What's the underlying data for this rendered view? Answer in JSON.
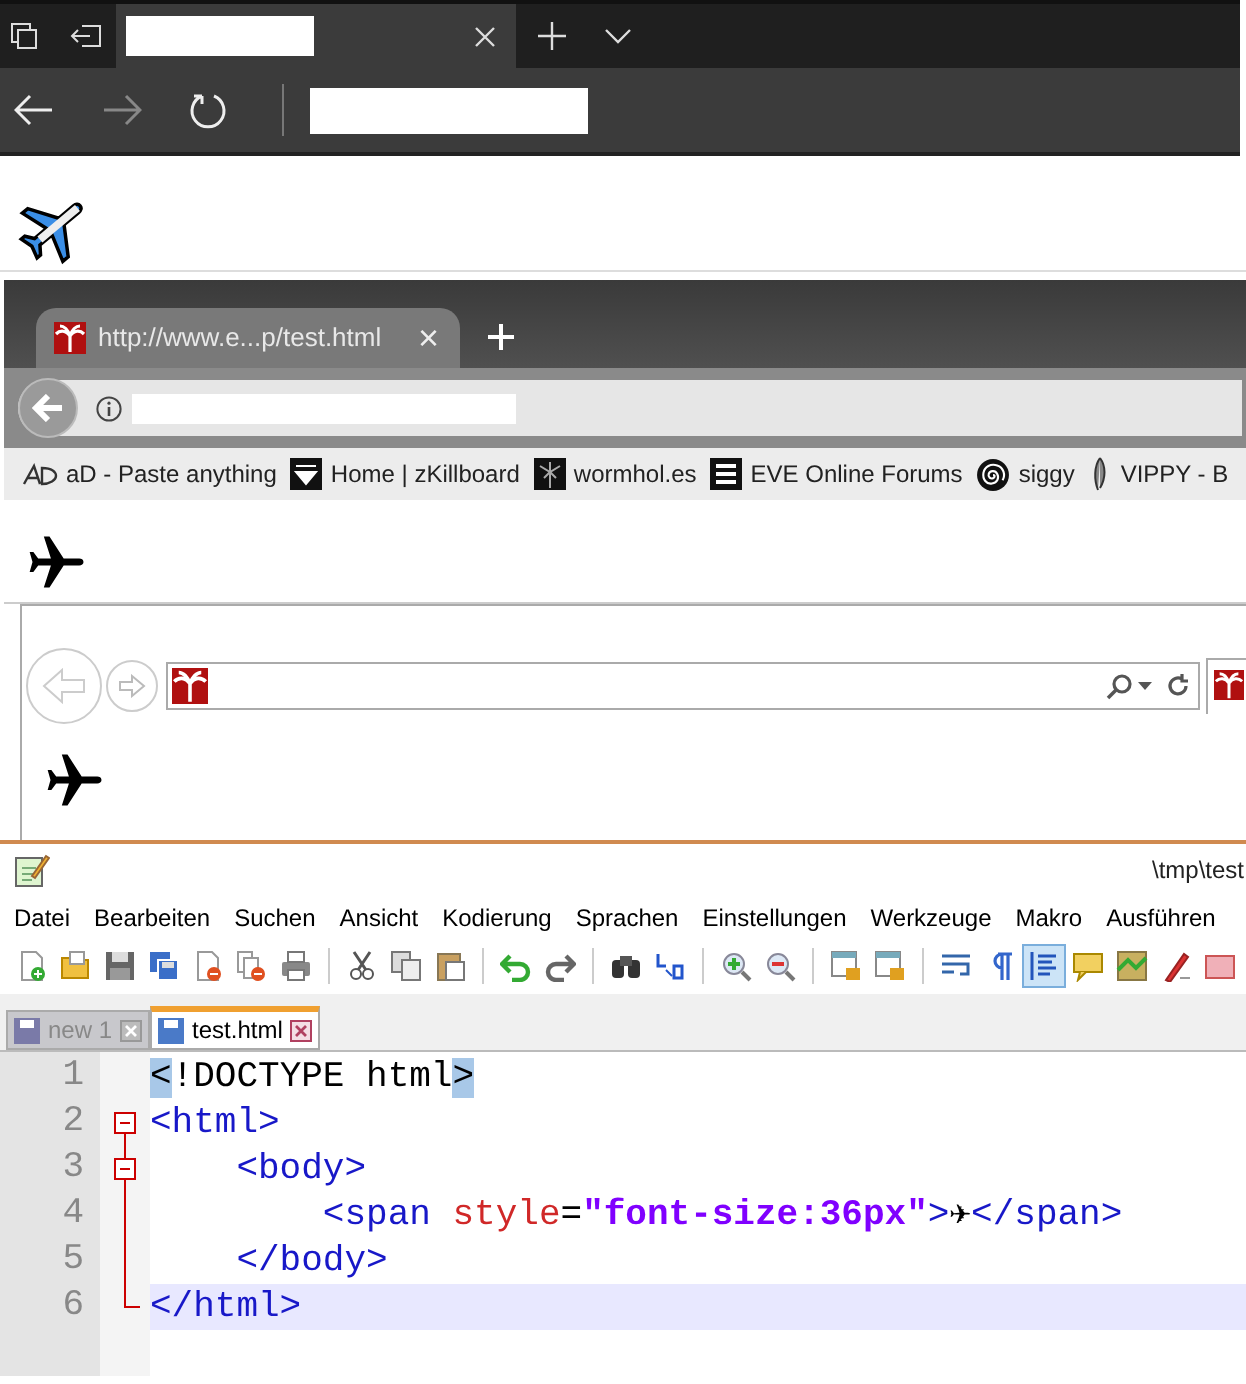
{
  "firefox": {
    "tab": {
      "title": "http://www.e...p/test.html",
      "close": "×"
    },
    "bookmarks": [
      {
        "label": "aD - Paste anything"
      },
      {
        "label": "Home | zKillboard"
      },
      {
        "label": "wormhol.es"
      },
      {
        "label": "EVE Online Forums"
      },
      {
        "label": "siggy"
      },
      {
        "label": "VIPPY - B"
      }
    ]
  },
  "notepad": {
    "title": "\\tmp\\test",
    "menu": [
      "Datei",
      "Bearbeiten",
      "Suchen",
      "Ansicht",
      "Kodierung",
      "Sprachen",
      "Einstellungen",
      "Werkzeuge",
      "Makro",
      "Ausführen"
    ],
    "toolbar": [
      {
        "pressed": false
      },
      {
        "pressed": false
      },
      {
        "pressed": false
      },
      {
        "pressed": false
      },
      {
        "pressed": false
      },
      {
        "pressed": false
      },
      {
        "pressed": false
      },
      {
        "pressed": false
      },
      {
        "pressed": false
      },
      {
        "pressed": false
      },
      {
        "pressed": false
      },
      {
        "pressed": false
      },
      {
        "pressed": false
      },
      {
        "pressed": false
      },
      {
        "pressed": false
      },
      {
        "pressed": false
      },
      {
        "pressed": false
      },
      {
        "pressed": false
      },
      {
        "pressed": false
      },
      {
        "pressed": false
      },
      {
        "pressed": true
      },
      {
        "pressed": false
      },
      {
        "pressed": false
      },
      {
        "pressed": false
      },
      {
        "pressed": false
      }
    ],
    "tabs": [
      {
        "label": "new 1",
        "selected": false
      },
      {
        "label": "test.html",
        "selected": true
      }
    ],
    "lines": [
      {
        "number": "1",
        "current": false,
        "foldable": false,
        "tokens": [
          {
            "kind": "match",
            "text": "<"
          },
          {
            "kind": "plain",
            "text": "!DOCTYPE html"
          },
          {
            "kind": "match",
            "text": ">"
          }
        ]
      },
      {
        "number": "2",
        "current": false,
        "foldable": true,
        "tokens": [
          {
            "kind": "tag",
            "text": "<html>"
          }
        ]
      },
      {
        "number": "3",
        "current": false,
        "foldable": true,
        "tokens": [
          {
            "kind": "tag",
            "text": "    <body>"
          }
        ]
      },
      {
        "number": "4",
        "current": false,
        "foldable": false,
        "tokens": [
          {
            "kind": "tag",
            "text": "        <span "
          },
          {
            "kind": "attr",
            "text": "style"
          },
          {
            "kind": "plain",
            "text": "="
          },
          {
            "kind": "string",
            "text": "\"font-size:36px\""
          },
          {
            "kind": "tag",
            "text": ">"
          },
          {
            "kind": "plain",
            "text": "✈"
          },
          {
            "kind": "tag",
            "text": "</span>"
          }
        ]
      },
      {
        "number": "5",
        "current": false,
        "foldable": false,
        "tokens": [
          {
            "kind": "tag",
            "text": "    </body>"
          }
        ]
      },
      {
        "number": "6",
        "current": true,
        "foldable": false,
        "tokens": [
          {
            "kind": "tag",
            "text": "</html>"
          }
        ]
      }
    ]
  }
}
